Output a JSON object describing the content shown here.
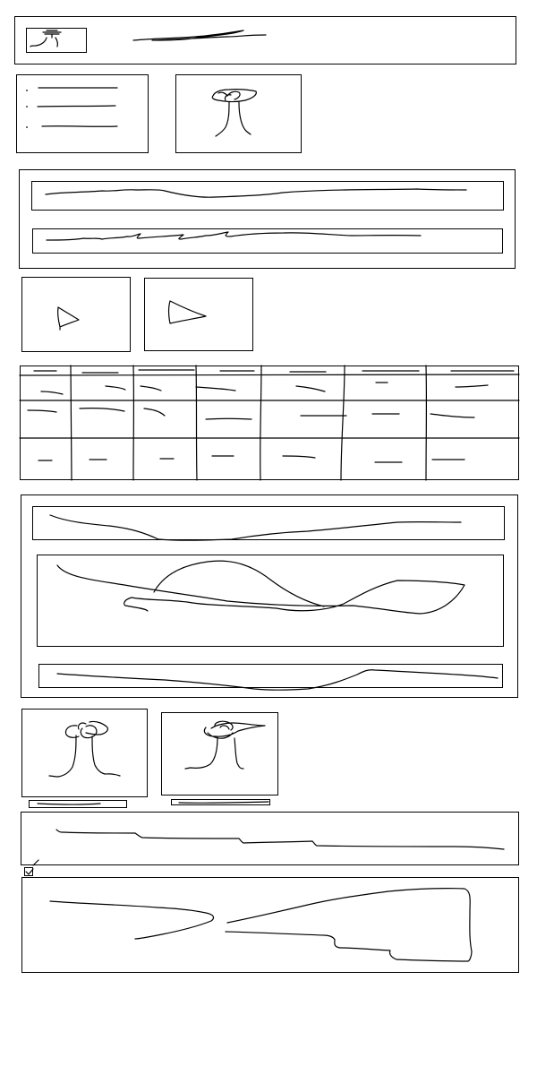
{
  "meta": {
    "sketch_wireframe": true
  },
  "header": {
    "logo": "",
    "title": ""
  },
  "nav_list": {
    "items": [
      "",
      "",
      ""
    ]
  },
  "cards_top": {
    "image_placeholder": ""
  },
  "form_section": {
    "field_1": "",
    "field_2": ""
  },
  "video_tiles": {
    "tiles": [
      "",
      ""
    ]
  },
  "table": {
    "columns": [
      "",
      "",
      "",
      "",
      "",
      "",
      ""
    ],
    "rows": [
      [
        "",
        "",
        "",
        "",
        "",
        "",
        ""
      ],
      [
        "",
        "",
        "",
        "",
        "",
        "",
        ""
      ],
      [
        "",
        "",
        "",
        "",
        "",
        "",
        ""
      ]
    ]
  },
  "content_panel": {
    "heading": "",
    "body": "",
    "footer": ""
  },
  "gallery": {
    "captions": [
      "",
      ""
    ]
  },
  "text_block": {
    "text": ""
  },
  "comment_box": {
    "checkbox_checked": true,
    "text": ""
  }
}
